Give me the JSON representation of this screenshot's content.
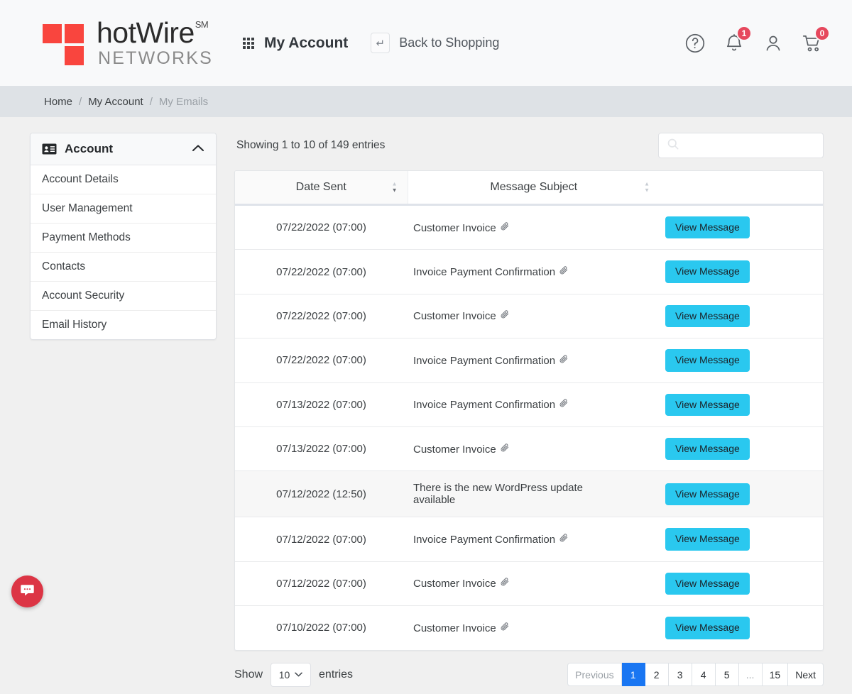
{
  "header": {
    "logo": {
      "word": "hotWire",
      "sm": "SM",
      "sub": "NETWORKS",
      "color": "#f9453e"
    },
    "nav_title": "My Account",
    "back_label": "Back to Shopping",
    "icons": {
      "help": "help-circle-icon",
      "bell": "bell-icon",
      "bell_badge": "1",
      "user": "user-icon",
      "cart": "cart-icon",
      "cart_badge": "0",
      "badge_color": "#e6485d"
    }
  },
  "breadcrumb": {
    "home": "Home",
    "sep": "/",
    "account": "My Account",
    "current": "My Emails"
  },
  "sidebar": {
    "title": "Account",
    "items": [
      {
        "label": "Account Details"
      },
      {
        "label": "User Management"
      },
      {
        "label": "Payment Methods"
      },
      {
        "label": "Contacts"
      },
      {
        "label": "Account Security"
      },
      {
        "label": "Email History"
      }
    ]
  },
  "table": {
    "entries_info": "Showing 1 to 10 of 149 entries",
    "search_placeholder": "",
    "search_value": "",
    "columns": {
      "date": "Date Sent",
      "subject": "Message Subject",
      "action": ""
    },
    "action_label": "View Message",
    "rows": [
      {
        "date": "07/22/2022 (07:00)",
        "subject": "Customer Invoice",
        "attachment": true,
        "alt": false,
        "action": "View Message"
      },
      {
        "date": "07/22/2022 (07:00)",
        "subject": "Invoice Payment Confirmation",
        "attachment": true,
        "alt": false,
        "action": "View Message"
      },
      {
        "date": "07/22/2022 (07:00)",
        "subject": "Customer Invoice",
        "attachment": true,
        "alt": false,
        "action": "View Message"
      },
      {
        "date": "07/22/2022 (07:00)",
        "subject": "Invoice Payment Confirmation",
        "attachment": true,
        "alt": false,
        "action": "View Message"
      },
      {
        "date": "07/13/2022 (07:00)",
        "subject": "Invoice Payment Confirmation",
        "attachment": true,
        "alt": false,
        "action": "View Message"
      },
      {
        "date": "07/13/2022 (07:00)",
        "subject": "Customer Invoice",
        "attachment": true,
        "alt": false,
        "action": "View Message"
      },
      {
        "date": "07/12/2022 (12:50)",
        "subject": "There is the new WordPress update available",
        "attachment": false,
        "alt": true,
        "action": "View Message"
      },
      {
        "date": "07/12/2022 (07:00)",
        "subject": "Invoice Payment Confirmation",
        "attachment": true,
        "alt": false,
        "action": "View Message"
      },
      {
        "date": "07/12/2022 (07:00)",
        "subject": "Customer Invoice",
        "attachment": true,
        "alt": false,
        "action": "View Message"
      },
      {
        "date": "07/10/2022 (07:00)",
        "subject": "Customer Invoice",
        "attachment": true,
        "alt": false,
        "action": "View Message"
      }
    ]
  },
  "footer": {
    "show_label": "Show",
    "page_size": "10",
    "entries_label": "entries",
    "pagination": [
      "Previous",
      "1",
      "2",
      "3",
      "4",
      "5",
      "...",
      "15",
      "Next"
    ],
    "active_page": "1",
    "active_color": "#1976f2"
  },
  "chat": {
    "icon": "chat-bubble-icon",
    "color": "#dc3545"
  },
  "theme": {
    "button": "#2ac8ef",
    "brand_red": "#f9453e",
    "breadcrumb_bg": "#dee2e6"
  }
}
